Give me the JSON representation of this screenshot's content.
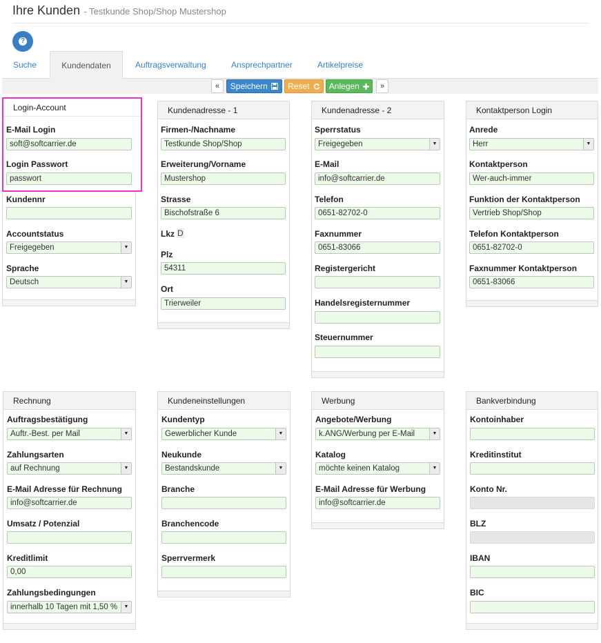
{
  "header": {
    "title": "Ihre Kunden",
    "subtitle": "- Testkunde Shop/Shop Mustershop"
  },
  "help": {
    "icon": "?"
  },
  "tabs": [
    "Suche",
    "Kundendaten",
    "Auftragsverwaltung",
    "Ansprechpartner",
    "Artikelpreise"
  ],
  "toolbar": {
    "prev": "«",
    "save": "Speichern",
    "reset": "Reset",
    "add": "Anlegen",
    "next": "»"
  },
  "panels": {
    "login": {
      "title": "Login-Account",
      "email_label": "E-Mail Login",
      "email_value": "soft@softcarrier.de",
      "pw_label": "Login Passwort",
      "pw_value": "passwort",
      "kundennr_label": "Kundennr",
      "kundennr_value": "",
      "status_label": "Accountstatus",
      "status_value": "Freigegeben",
      "sprache_label": "Sprache",
      "sprache_value": "Deutsch"
    },
    "addr1": {
      "title": "Kundenadresse - 1",
      "firma_label": "Firmen-/Nachname",
      "firma_value": "Testkunde Shop/Shop",
      "erw_label": "Erweiterung/Vorname",
      "erw_value": "Mustershop",
      "strasse_label": "Strasse",
      "strasse_value": "Bischofstraße 6",
      "lkz_label": "Lkz",
      "lkz_value": "D",
      "plz_label": "Plz",
      "plz_value": "54311",
      "ort_label": "Ort",
      "ort_value": "Trierweiler"
    },
    "addr2": {
      "title": "Kundenadresse - 2",
      "sperr_label": "Sperrstatus",
      "sperr_value": "Freigegeben",
      "email_label": "E-Mail",
      "email_value": "info@softcarrier.de",
      "tel_label": "Telefon",
      "tel_value": "0651-82702-0",
      "fax_label": "Faxnummer",
      "fax_value": "0651-83066",
      "reg_label": "Registergericht",
      "reg_value": "",
      "hrn_label": "Handelsregisternummer",
      "hrn_value": "",
      "steuer_label": "Steuernummer",
      "steuer_value": ""
    },
    "kontakt": {
      "title": "Kontaktperson Login",
      "anrede_label": "Anrede",
      "anrede_value": "Herr",
      "person_label": "Kontaktperson",
      "person_value": "Wer-auch-immer",
      "funktion_label": "Funktion der Kontaktperson",
      "funktion_value": "Vertrieb Shop/Shop",
      "tel_label": "Telefon Kontaktperson",
      "tel_value": "0651-82702-0",
      "fax_label": "Faxnummer Kontaktperson",
      "fax_value": "0651-83066"
    },
    "rechnung": {
      "title": "Rechnung",
      "ab_label": "Auftragsbestätigung",
      "ab_value": "Auftr.-Best. per Mail",
      "zahlarten_label": "Zahlungsarten",
      "zahlarten_value": "auf Rechnung",
      "email_label": "E-Mail Adresse für Rechnung",
      "email_value": "info@softcarrier.de",
      "umsatz_label": "Umsatz / Potenzial",
      "umsatz_value": "",
      "kredit_label": "Kreditlimit",
      "kredit_value": "0,00",
      "zahlbed_label": "Zahlungsbedingungen",
      "zahlbed_value": "innerhalb 10 Tagen mit 1,50 %"
    },
    "einst": {
      "title": "Kundeneinstellungen",
      "typ_label": "Kundentyp",
      "typ_value": "Gewerblicher Kunde",
      "neu_label": "Neukunde",
      "neu_value": "Bestandskunde",
      "branche_label": "Branche",
      "branche_value": "",
      "bcode_label": "Branchencode",
      "bcode_value": "",
      "sperrv_label": "Sperrvermerk",
      "sperrv_value": ""
    },
    "werbung": {
      "title": "Werbung",
      "angebote_label": "Angebote/Werbung",
      "angebote_value": "k.ANG/Werbung per E-Mail",
      "katalog_label": "Katalog",
      "katalog_value": "möchte keinen Katalog",
      "email_label": "E-Mail Adresse für Werbung",
      "email_value": "info@softcarrier.de"
    },
    "bank": {
      "title": "Bankverbindung",
      "inhaber_label": "Kontoinhaber",
      "inhaber_value": "",
      "institut_label": "Kreditinstitut",
      "institut_value": "",
      "konto_label": "Konto Nr.",
      "konto_value": "",
      "blz_label": "BLZ",
      "blz_value": "",
      "iban_label": "IBAN",
      "iban_value": "",
      "bic_label": "BIC",
      "bic_value": ""
    }
  }
}
